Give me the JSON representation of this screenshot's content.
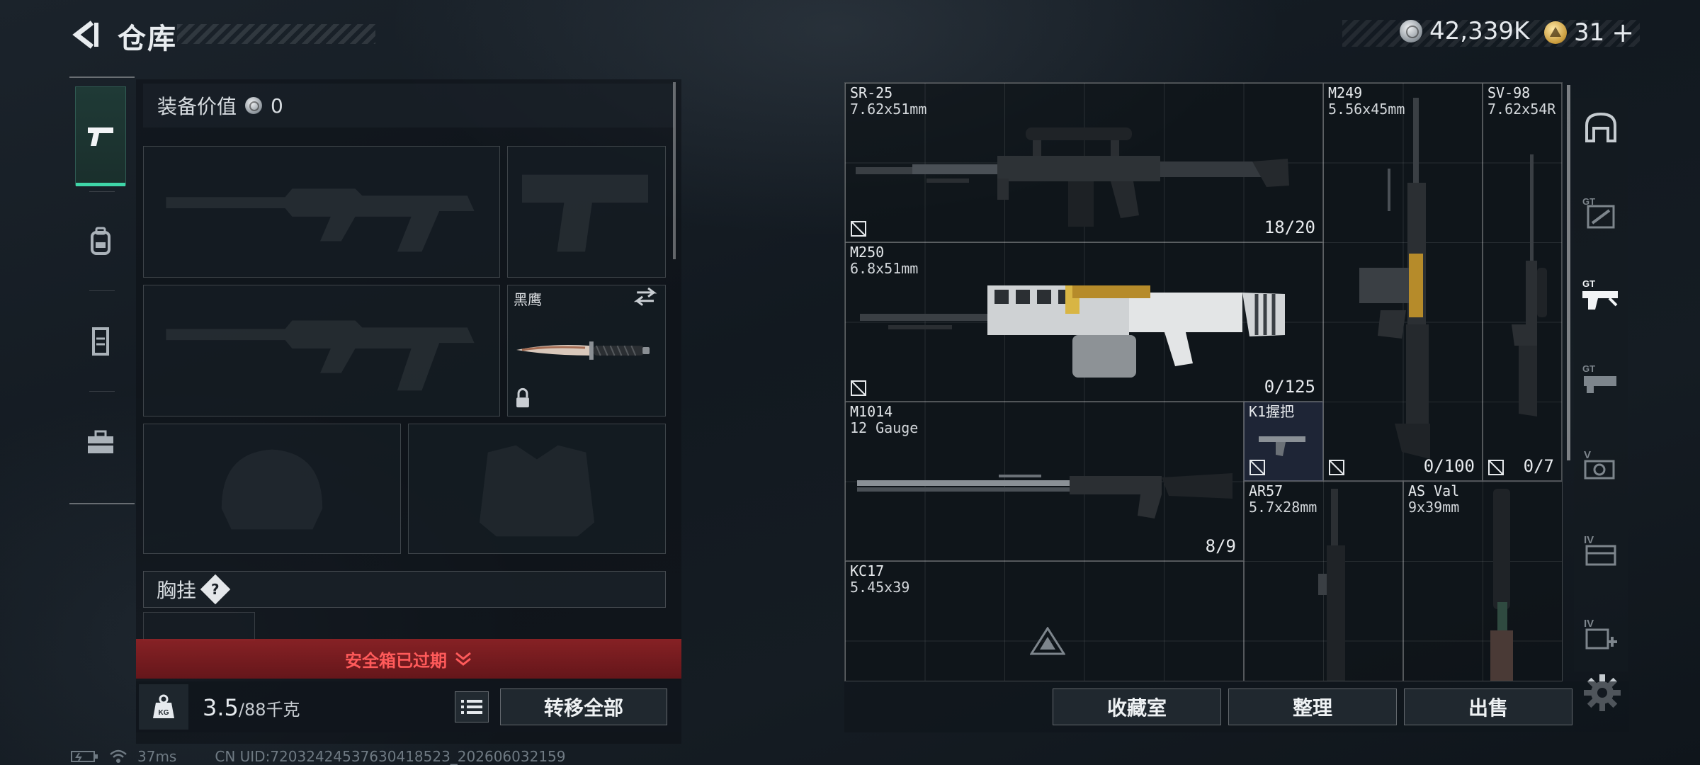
{
  "header": {
    "title": "仓库",
    "currency_silver": "42,339K",
    "currency_gold": "31",
    "add_symbol": "+"
  },
  "sidebar": {
    "tabs": [
      {
        "icon": "pistol-icon",
        "active": true
      },
      {
        "icon": "backpack-icon",
        "active": false
      },
      {
        "icon": "vest-icon",
        "active": false
      },
      {
        "icon": "toolbox-icon",
        "active": false
      }
    ]
  },
  "equipment": {
    "value_label": "装备价值",
    "value": "0",
    "melee_name": "黑鹰",
    "chest_label": "胸挂",
    "help_symbol": "?",
    "safebox_text": "安全箱已过期",
    "weight_current": "3.5",
    "weight_max": "/88千克",
    "transfer_all_label": "转移全部"
  },
  "stash": {
    "items": [
      {
        "name": "SR-25",
        "caliber": "7.62x51mm",
        "ammo": "18/20"
      },
      {
        "name": "M250",
        "caliber": "6.8x51mm",
        "ammo": "0/125"
      },
      {
        "name": "M1014",
        "caliber": "12 Gauge",
        "ammo": "8/9"
      },
      {
        "name": "KC17",
        "caliber": "5.45x39",
        "ammo": ""
      },
      {
        "name": "M249",
        "caliber": "5.56x45mm",
        "ammo": "0/100"
      },
      {
        "name": "SV-98",
        "caliber": "7.62x54R",
        "ammo": "0/7"
      },
      {
        "name": "K1握把",
        "caliber": "",
        "ammo": ""
      },
      {
        "name": "AR57",
        "caliber": "5.7x28mm",
        "ammo": ""
      },
      {
        "name": "AS Val",
        "caliber": "9x39mm",
        "ammo": ""
      }
    ]
  },
  "filters": [
    "helmet-filter-icon",
    "gt-weapon-filter-icon",
    "gt-rifle-filter-icon",
    "gt-ammo-filter-icon",
    "v-filter-icon",
    "iv-filter-icon",
    "iv-plus-filter-icon"
  ],
  "actions": {
    "collection_label": "收藏室",
    "organize_label": "整理",
    "sell_label": "出售"
  },
  "status": {
    "ping": "37ms",
    "uid": "CN UID:720324245376304185​23_202606032159"
  },
  "colors": {
    "accent": "#3fd6a8",
    "warning": "#ff5a5a",
    "banner_bg": "#8a1e22"
  }
}
